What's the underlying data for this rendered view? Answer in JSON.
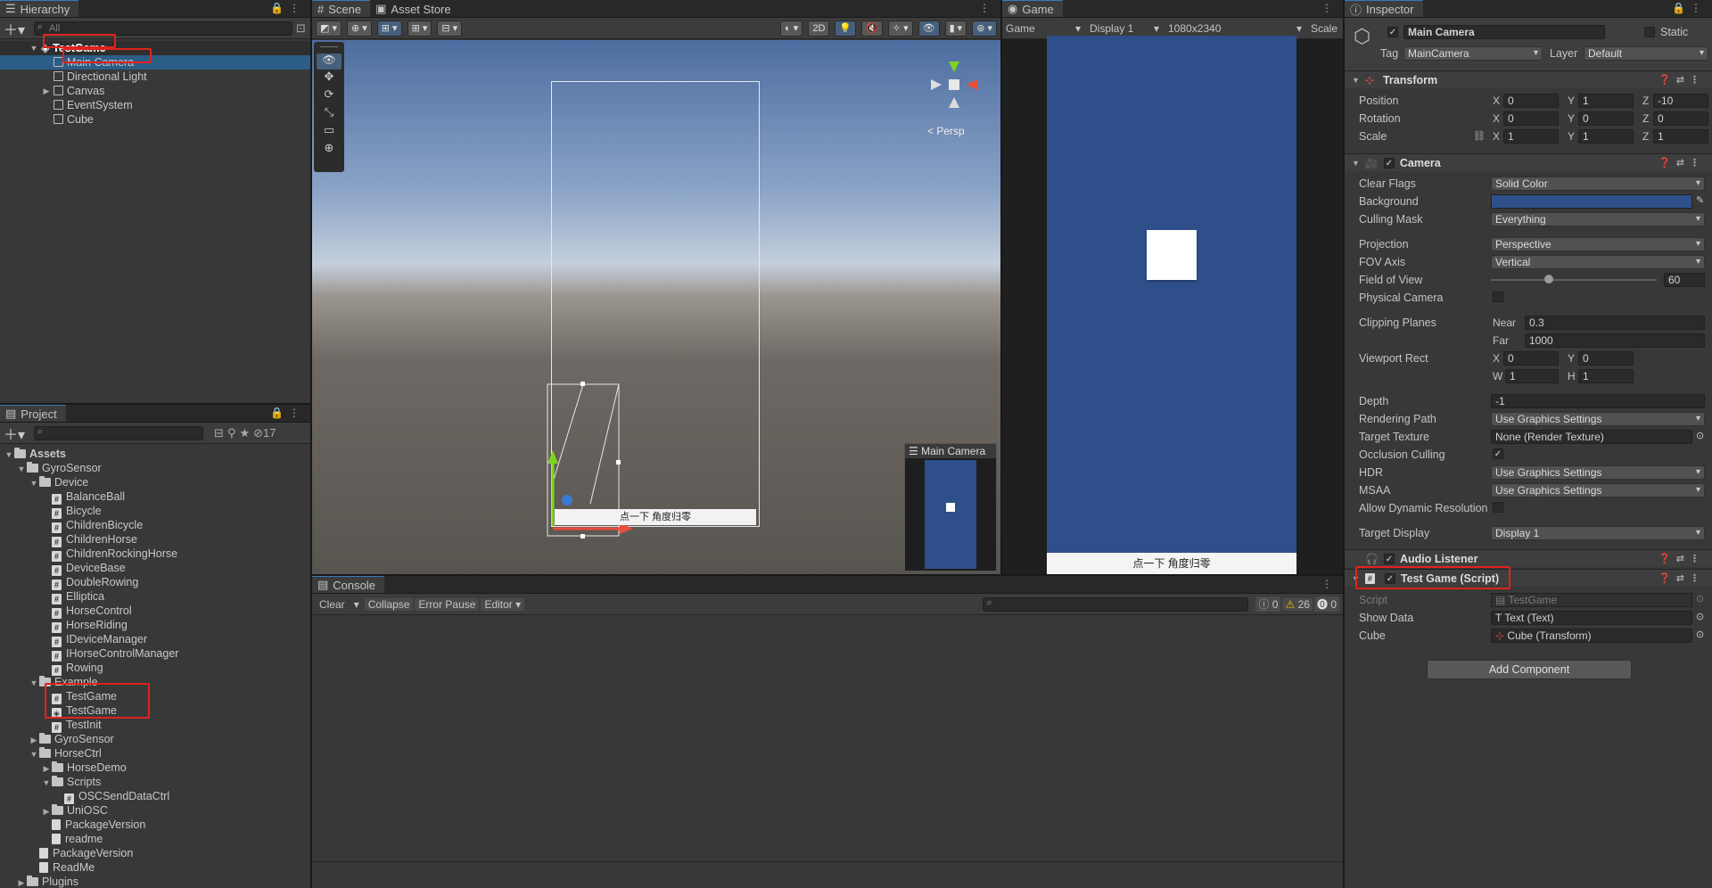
{
  "hierarchy": {
    "tab": "Hierarchy",
    "search_placeholder": "All",
    "scene": "TestGame",
    "items": [
      "Main Camera",
      "Directional Light",
      "Canvas",
      "EventSystem",
      "Cube"
    ]
  },
  "scene_view": {
    "tabs": [
      "Scene",
      "Asset Store"
    ],
    "btn_2d": "2D",
    "persp": "Persp",
    "scene_button_text": "点一下 角度归零",
    "cam_preview_title": "Main Camera"
  },
  "game_view": {
    "tab": "Game",
    "mode": "Game",
    "display": "Display 1",
    "resolution": "1080x2340",
    "scale": "Scale",
    "button_text": "点一下 角度归零",
    "bg_color": "#2f4f8a"
  },
  "inspector": {
    "tab": "Inspector",
    "object_name": "Main Camera",
    "static_label": "Static",
    "tag_label": "Tag",
    "tag_value": "MainCamera",
    "layer_label": "Layer",
    "layer_value": "Default",
    "transform": {
      "title": "Transform",
      "position_label": "Position",
      "position": [
        "0",
        "1",
        "-10"
      ],
      "rotation_label": "Rotation",
      "rotation": [
        "0",
        "0",
        "0"
      ],
      "scale_label": "Scale",
      "scale": [
        "1",
        "1",
        "1"
      ]
    },
    "camera": {
      "title": "Camera",
      "clear_flags_label": "Clear Flags",
      "clear_flags": "Solid Color",
      "background_label": "Background",
      "culling_mask_label": "Culling Mask",
      "culling_mask": "Everything",
      "projection_label": "Projection",
      "projection": "Perspective",
      "fov_axis_label": "FOV Axis",
      "fov_axis": "Vertical",
      "fov_label": "Field of View",
      "fov": "60",
      "physical_label": "Physical Camera",
      "clipping_label": "Clipping Planes",
      "near_label": "Near",
      "near": "0.3",
      "far_label": "Far",
      "far": "1000",
      "viewport_label": "Viewport Rect",
      "vp_x": "0",
      "vp_y": "0",
      "vp_w": "1",
      "vp_h": "1",
      "depth_label": "Depth",
      "depth": "-1",
      "rendering_path_label": "Rendering Path",
      "rendering_path": "Use Graphics Settings",
      "target_texture_label": "Target Texture",
      "target_texture": "None (Render Texture)",
      "occlusion_label": "Occlusion Culling",
      "hdr_label": "HDR",
      "hdr": "Use Graphics Settings",
      "msaa_label": "MSAA",
      "msaa": "Use Graphics Settings",
      "dyn_res_label": "Allow Dynamic Resolution",
      "target_display_label": "Target Display",
      "target_display": "Display 1"
    },
    "audio_listener": "Audio Listener",
    "test_game": {
      "title": "Test Game (Script)",
      "script_label": "Script",
      "script": "TestGame",
      "show_data_label": "Show Data",
      "show_data": "Text (Text)",
      "cube_label": "Cube",
      "cube": "Cube (Transform)"
    },
    "add_component": "Add Component"
  },
  "project": {
    "tab": "Project",
    "hidden_count": "17",
    "tree": [
      {
        "label": "Assets",
        "indent": 0,
        "kind": "folder",
        "arrow": "▼"
      },
      {
        "label": "GyroSensor",
        "indent": 1,
        "kind": "folder",
        "arrow": "▼"
      },
      {
        "label": "Device",
        "indent": 2,
        "kind": "folder",
        "arrow": "▼"
      },
      {
        "label": "BalanceBall",
        "indent": 3,
        "kind": "script",
        "arrow": ""
      },
      {
        "label": "Bicycle",
        "indent": 3,
        "kind": "script",
        "arrow": ""
      },
      {
        "label": "ChildrenBicycle",
        "indent": 3,
        "kind": "script",
        "arrow": ""
      },
      {
        "label": "ChildrenHorse",
        "indent": 3,
        "kind": "script",
        "arrow": ""
      },
      {
        "label": "ChildrenRockingHorse",
        "indent": 3,
        "kind": "script",
        "arrow": ""
      },
      {
        "label": "DeviceBase",
        "indent": 3,
        "kind": "script",
        "arrow": ""
      },
      {
        "label": "DoubleRowing",
        "indent": 3,
        "kind": "script",
        "arrow": ""
      },
      {
        "label": "Elliptica",
        "indent": 3,
        "kind": "script",
        "arrow": ""
      },
      {
        "label": "HorseControl",
        "indent": 3,
        "kind": "script",
        "arrow": ""
      },
      {
        "label": "HorseRiding",
        "indent": 3,
        "kind": "script",
        "arrow": ""
      },
      {
        "label": "IDeviceManager",
        "indent": 3,
        "kind": "script",
        "arrow": ""
      },
      {
        "label": "IHorseControlManager",
        "indent": 3,
        "kind": "script",
        "arrow": ""
      },
      {
        "label": "Rowing",
        "indent": 3,
        "kind": "script",
        "arrow": ""
      },
      {
        "label": "Example",
        "indent": 2,
        "kind": "folder",
        "arrow": "▼"
      },
      {
        "label": "TestGame",
        "indent": 3,
        "kind": "script",
        "arrow": ""
      },
      {
        "label": "TestGame",
        "indent": 3,
        "kind": "scene",
        "arrow": ""
      },
      {
        "label": "TestInit",
        "indent": 3,
        "kind": "script",
        "arrow": ""
      },
      {
        "label": "GyroSensor",
        "indent": 2,
        "kind": "folder",
        "arrow": "▶"
      },
      {
        "label": "HorseCtrl",
        "indent": 2,
        "kind": "folder",
        "arrow": "▼"
      },
      {
        "label": "HorseDemo",
        "indent": 3,
        "kind": "folder",
        "arrow": "▶"
      },
      {
        "label": "Scripts",
        "indent": 3,
        "kind": "folder",
        "arrow": "▼"
      },
      {
        "label": "OSCSendDataCtrl",
        "indent": 4,
        "kind": "script",
        "arrow": ""
      },
      {
        "label": "UniOSC",
        "indent": 3,
        "kind": "folder",
        "arrow": "▶"
      },
      {
        "label": "PackageVersion",
        "indent": 3,
        "kind": "doc",
        "arrow": ""
      },
      {
        "label": "readme",
        "indent": 3,
        "kind": "doc",
        "arrow": ""
      },
      {
        "label": "PackageVersion",
        "indent": 2,
        "kind": "doc",
        "arrow": ""
      },
      {
        "label": "ReadMe",
        "indent": 2,
        "kind": "doc",
        "arrow": ""
      },
      {
        "label": "Plugins",
        "indent": 1,
        "kind": "folder",
        "arrow": "▶"
      }
    ]
  },
  "console": {
    "tab": "Console",
    "clear": "Clear",
    "collapse": "Collapse",
    "error_pause": "Error Pause",
    "editor": "Editor",
    "info_count": "0",
    "warn_count": "26",
    "error_count": "0"
  }
}
